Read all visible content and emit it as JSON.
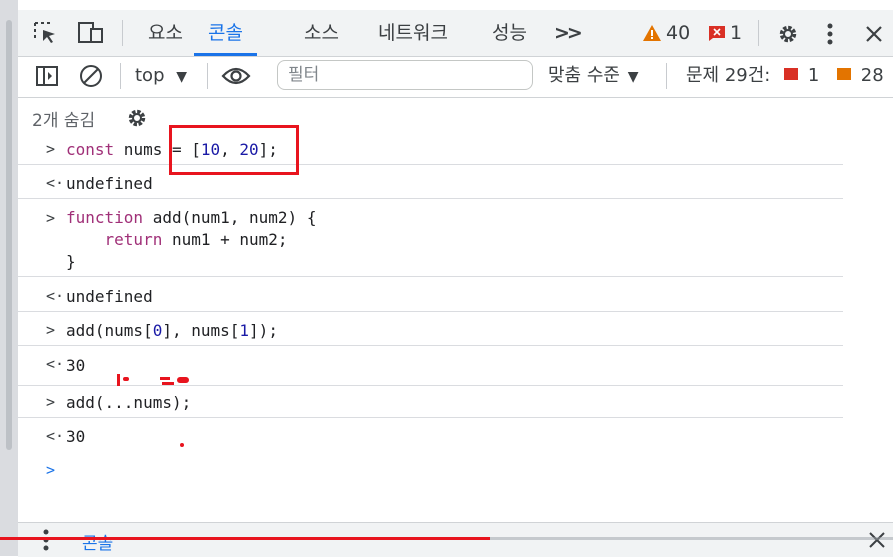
{
  "tabs": [
    "요소",
    "콘솔",
    "소스",
    "네트워크",
    "성능"
  ],
  "active_tab": "콘솔",
  "more_tabs_label": ">>",
  "status": {
    "warnings": "40",
    "errors": "1"
  },
  "toolbar": {
    "context": "top",
    "filter_placeholder": "필터",
    "levels": "맞춤 수준",
    "issues_label": "문제 29건:",
    "issues_errors": "1",
    "issues_warnings": "28"
  },
  "hidden_label": "2개 숨김",
  "console": [
    {
      "type": "input",
      "prefix": ">",
      "lines": [
        "const nums = [10, 20];"
      ]
    },
    {
      "type": "output",
      "prefix": "<·",
      "lines": [
        "undefined"
      ]
    },
    {
      "type": "input",
      "prefix": ">",
      "lines": [
        "function add(num1, num2) {",
        "    return num1 + num2;",
        "}"
      ]
    },
    {
      "type": "output",
      "prefix": "<·",
      "lines": [
        "undefined"
      ]
    },
    {
      "type": "input",
      "prefix": ">",
      "lines": [
        "add(nums[0], nums[1]);"
      ]
    },
    {
      "type": "output",
      "prefix": "<·",
      "lines": [
        "30"
      ]
    },
    {
      "type": "input",
      "prefix": ">",
      "lines": [
        "add(...nums);"
      ]
    },
    {
      "type": "output",
      "prefix": "<·",
      "lines": [
        "30"
      ]
    }
  ],
  "prompt": ">",
  "drawer": {
    "label": "콘솔"
  },
  "colors": {
    "accent": "#1a73e8",
    "annotation": "#e8141e",
    "keyword": "#a03078",
    "number": "#1a1aa6"
  },
  "video_progress": 0.55
}
